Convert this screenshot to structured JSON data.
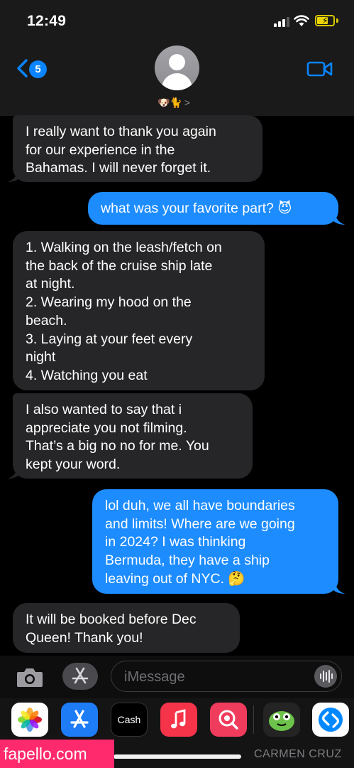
{
  "status_bar": {
    "time": "12:49"
  },
  "nav": {
    "back_badge": "5",
    "contact_name": "🐶🐈",
    "contact_chevron": ">"
  },
  "messages": [
    {
      "direction": "received",
      "text": "I really want to thank you again\nfor our experience in the\nBahamas. I will never forget it."
    },
    {
      "direction": "sent",
      "text": "what was your favorite part? 😈"
    },
    {
      "direction": "received",
      "text": "1. Walking on the leash/fetch on\nthe back of the cruise ship late\nat night.\n2. Wearing my hood on the\nbeach.\n3. Laying at your feet every\nnight\n4. Watching you eat"
    },
    {
      "direction": "received",
      "text": "I also wanted to say that i\nappreciate you not filming.\nThat’s a big no no for me. You\nkept your word."
    },
    {
      "direction": "sent",
      "text": "lol duh, we all have boundaries\nand limits! Where are we going\nin 2024? I was thinking\nBermuda, they have a ship\nleaving out of NYC. 🤔"
    },
    {
      "direction": "received",
      "text": "It will be booked before Dec\nQueen! Thank you!"
    }
  ],
  "input": {
    "placeholder": "iMessage"
  },
  "app_drawer": {
    "apps": [
      "photos-app",
      "app-store-app",
      "cash-app",
      "music-app",
      "search-app",
      "game-app",
      "shazam-app"
    ],
    "cash_label": "Cash"
  },
  "watermarks": {
    "left": "fapello.com",
    "right": "CARMEN CRUZ"
  },
  "colors": {
    "sent_bubble": "#1d8cff",
    "received_bubble": "#262628",
    "accent": "#0a84ff"
  }
}
